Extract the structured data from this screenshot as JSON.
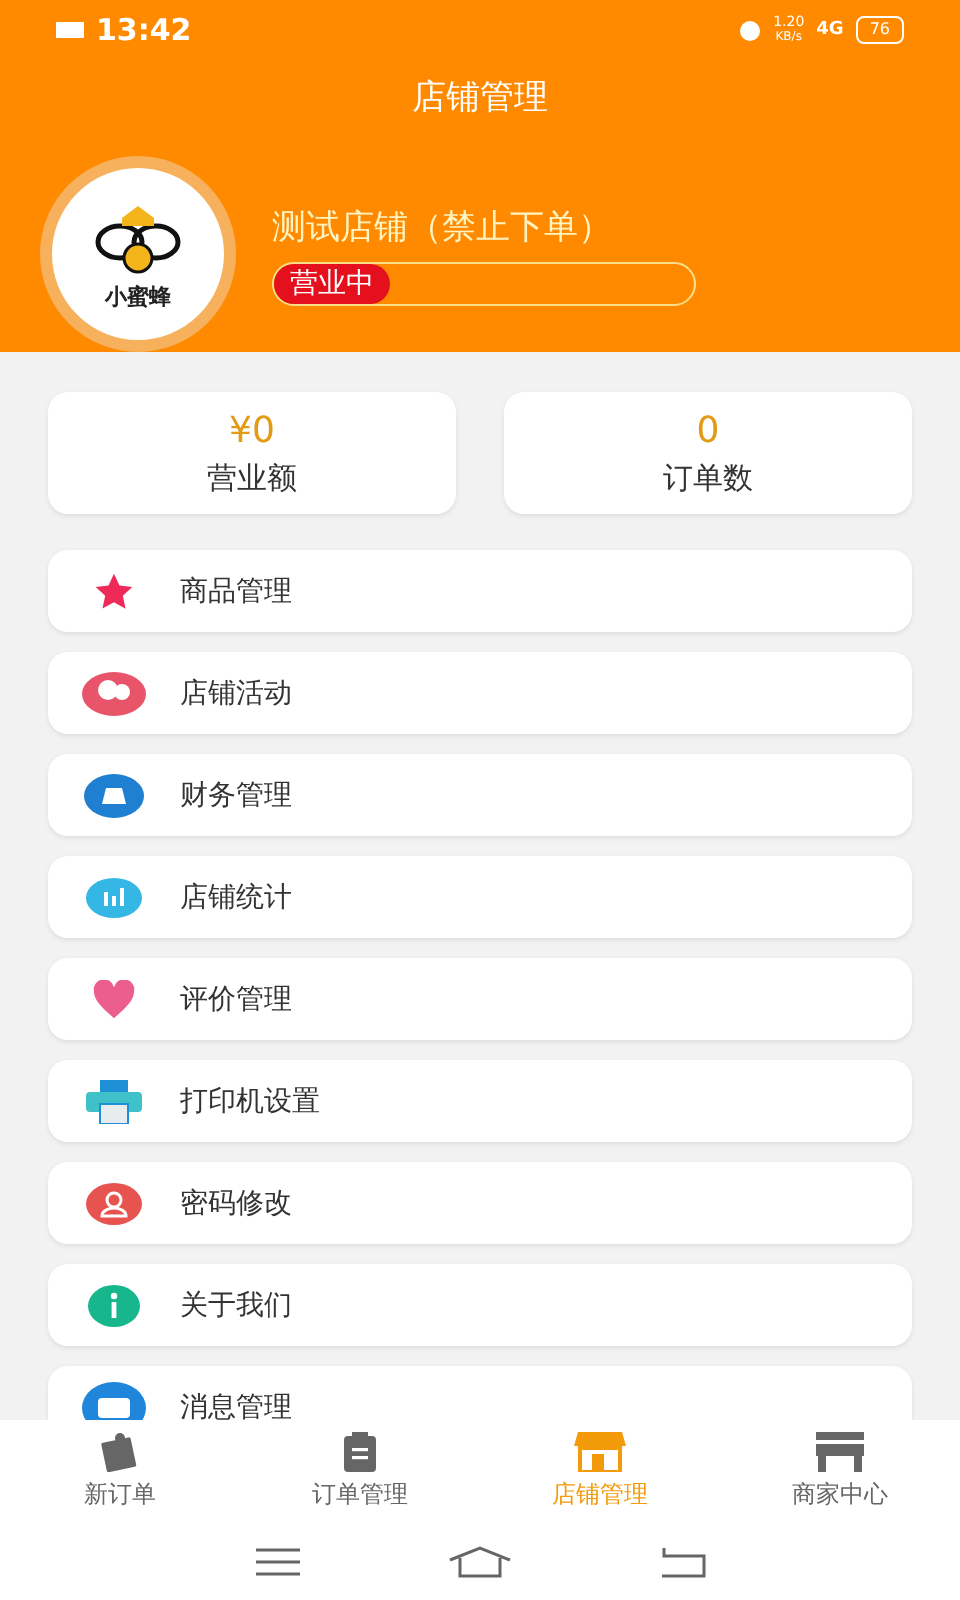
{
  "status_bar": {
    "time": "13:42",
    "speed": "1.20",
    "speed_unit": "KB/s",
    "network": "4G",
    "battery": "76"
  },
  "header": {
    "title": "店铺管理",
    "logo_text": "小蜜蜂",
    "store_name": "测试店铺（禁止下单）",
    "status": "营业中"
  },
  "stats": [
    {
      "value": "¥0",
      "label": "营业额"
    },
    {
      "value": "0",
      "label": "订单数"
    }
  ],
  "menu": [
    {
      "kind": "star",
      "label": "商品管理"
    },
    {
      "kind": "balloon",
      "label": "店铺活动"
    },
    {
      "kind": "money",
      "label": "财务管理"
    },
    {
      "kind": "chart",
      "label": "店铺统计"
    },
    {
      "kind": "heart",
      "label": "评价管理"
    },
    {
      "kind": "printer",
      "label": "打印机设置"
    },
    {
      "kind": "user",
      "label": "密码修改"
    },
    {
      "kind": "info",
      "label": "关于我们"
    },
    {
      "kind": "message",
      "label": "消息管理"
    }
  ],
  "tabs": [
    {
      "kind": "new",
      "label": "新订单",
      "selected": false
    },
    {
      "kind": "list",
      "label": "订单管理",
      "selected": false
    },
    {
      "kind": "shop",
      "label": "店铺管理",
      "selected": true
    },
    {
      "kind": "store",
      "label": "商家中心",
      "selected": false
    }
  ]
}
